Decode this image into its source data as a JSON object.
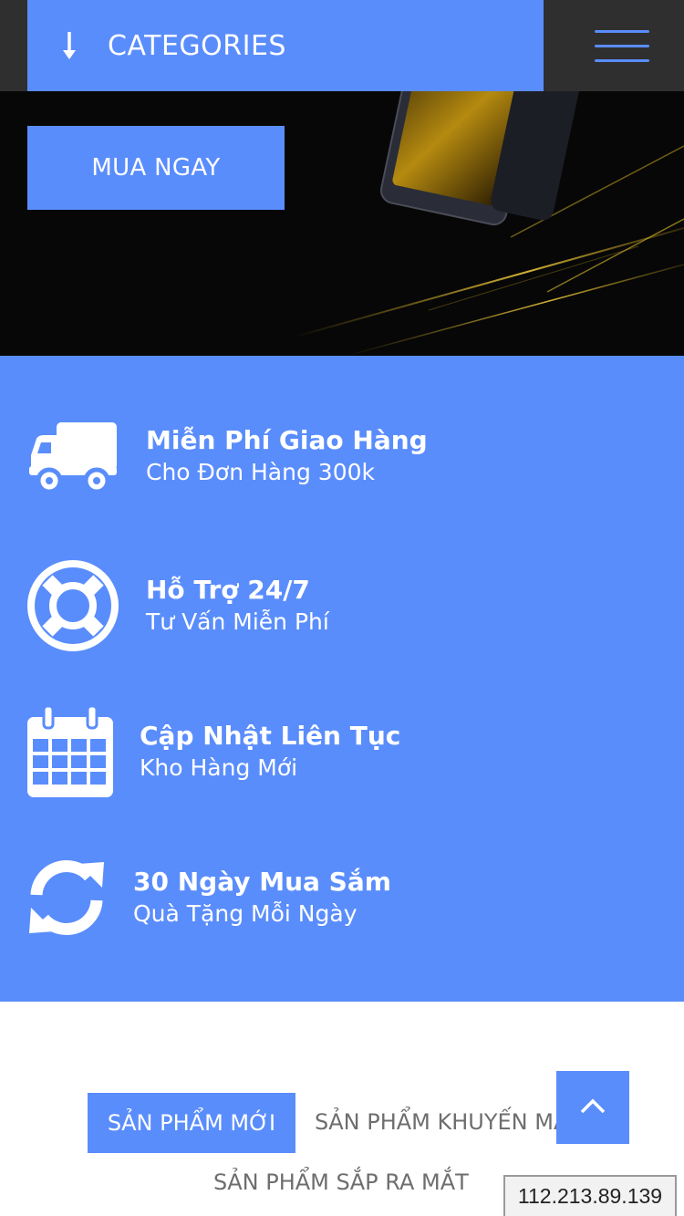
{
  "header": {
    "categories_label": "CATEGORIES",
    "categories_icon": "arrow-down-icon",
    "menu_icon": "hamburger-menu-icon"
  },
  "hero": {
    "buy_button_label": "MUA NGAY",
    "image": "smartphone-promo-image"
  },
  "features": [
    {
      "icon": "truck-icon",
      "title": "Miễn Phí Giao Hàng",
      "subtitle": "Cho Đơn Hàng 300k"
    },
    {
      "icon": "lifebuoy-icon",
      "title": "Hỗ Trợ 24/7",
      "subtitle": "Tư Vấn Miễn Phí"
    },
    {
      "icon": "calendar-icon",
      "title": "Cập Nhật Liên Tục",
      "subtitle": "Kho Hàng Mới"
    },
    {
      "icon": "refresh-icon",
      "title": "30 Ngày Mua Sắm",
      "subtitle": "Quà Tặng Mỗi Ngày"
    }
  ],
  "product_tabs": [
    {
      "label": "SẢN PHẨM MỚI",
      "active": true
    },
    {
      "label": "SẢN PHẨM KHUYẾN MÃI",
      "active": false
    },
    {
      "label": "SẢN PHẨM SẮP RA MẮT",
      "active": false
    }
  ],
  "scroll_top_icon": "chevron-up-icon",
  "ip_address": "112.213.89.139",
  "colors": {
    "accent": "#5a8dfc",
    "topbar": "#2f2f2f",
    "tab_text": "#6e6e6e"
  }
}
